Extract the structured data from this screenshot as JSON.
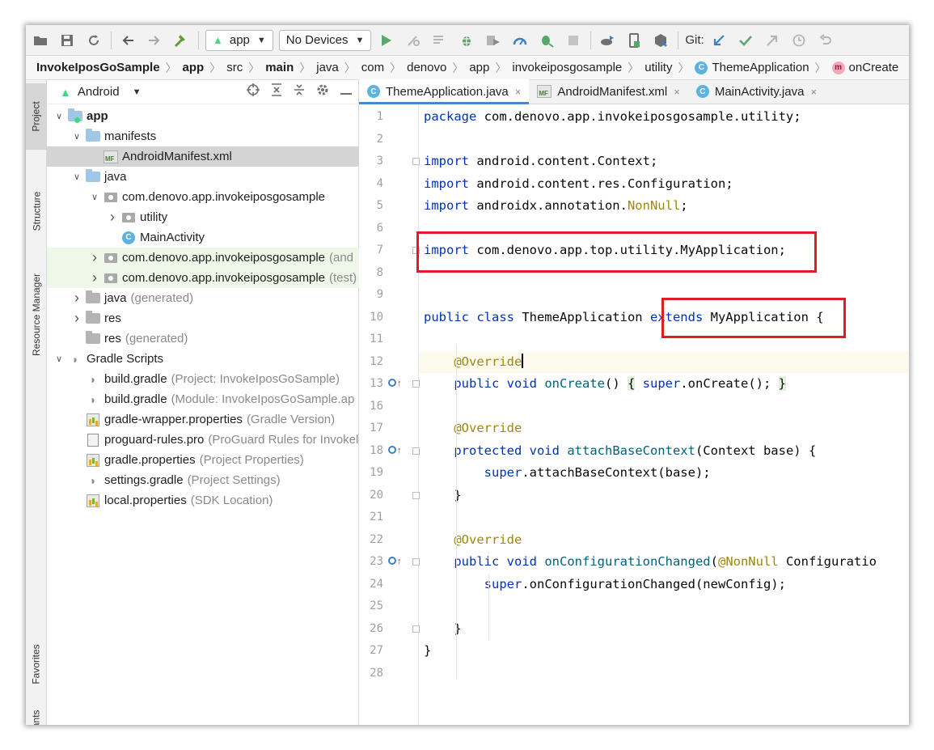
{
  "toolbar": {
    "config_selector": "app",
    "device_selector": "No Devices",
    "git_label": "Git:",
    "icons": [
      "open-folder-icon",
      "save-icon",
      "sync-icon",
      "back-icon",
      "forward-icon",
      "build-hammer-icon",
      "run-icon",
      "apply-changes-icon",
      "apply-code-changes-icon",
      "debug-icon",
      "run-with-coverage-icon",
      "profile-icon",
      "attach-debugger-icon",
      "stop-icon",
      "sync-gradle-icon",
      "device-manager-icon",
      "sdk-manager-icon",
      "git-update-icon",
      "git-commit-icon",
      "git-push-icon",
      "history-icon",
      "rollback-icon"
    ]
  },
  "breadcrumb": {
    "items": [
      "InvokeIposGoSample",
      "app",
      "src",
      "main",
      "java",
      "com",
      "denovo",
      "app",
      "invokeiposgosample",
      "utility",
      "ThemeApplication",
      "onCreate"
    ],
    "class_badge": "C",
    "method_badge": "m"
  },
  "left_strip": {
    "tabs": [
      "Project",
      "Structure",
      "Resource Manager",
      "Favorites",
      "Variants"
    ]
  },
  "project_panel": {
    "view_selector": "Android",
    "tree": [
      {
        "label": "app",
        "muted": "",
        "indent": 0,
        "arrow": "down",
        "icon": "folder"
      },
      {
        "label": "manifests",
        "muted": "",
        "indent": 1,
        "arrow": "down",
        "icon": "folder"
      },
      {
        "label": "AndroidManifest.xml",
        "muted": "",
        "indent": 2,
        "arrow": "",
        "icon": "mf"
      },
      {
        "label": "java",
        "muted": "",
        "indent": 1,
        "arrow": "down",
        "icon": "folder"
      },
      {
        "label": "com.denovo.app.invokeiposgosample",
        "muted": "",
        "indent": 2,
        "arrow": "down",
        "icon": "pkg"
      },
      {
        "label": "utility",
        "muted": "",
        "indent": 3,
        "arrow": "right",
        "icon": "pkg"
      },
      {
        "label": "MainActivity",
        "muted": "",
        "indent": 3,
        "arrow": "",
        "icon": "cls"
      },
      {
        "label": "com.denovo.app.invokeiposgosample",
        "muted": "(and",
        "indent": 2,
        "arrow": "right",
        "icon": "pkg"
      },
      {
        "label": "com.denovo.app.invokeiposgosample",
        "muted": "(test)",
        "indent": 2,
        "arrow": "right",
        "icon": "pkg"
      },
      {
        "label": "java",
        "muted": "(generated)",
        "indent": 1,
        "arrow": "right",
        "icon": "folder-gray"
      },
      {
        "label": "res",
        "muted": "",
        "indent": 1,
        "arrow": "right",
        "icon": "folder-gray"
      },
      {
        "label": "res",
        "muted": "(generated)",
        "indent": 1,
        "arrow": "",
        "icon": "folder-gray"
      },
      {
        "label": "Gradle Scripts",
        "muted": "",
        "indent": 0,
        "arrow": "down",
        "icon": "gradle"
      },
      {
        "label": "build.gradle",
        "muted": "(Project: InvokeIposGoSample)",
        "indent": 1,
        "arrow": "",
        "icon": "gradle"
      },
      {
        "label": "build.gradle",
        "muted": "(Module: InvokeIposGoSample.ap",
        "indent": 1,
        "arrow": "",
        "icon": "gradle"
      },
      {
        "label": "gradle-wrapper.properties",
        "muted": "(Gradle Version)",
        "indent": 1,
        "arrow": "",
        "icon": "props"
      },
      {
        "label": "proguard-rules.pro",
        "muted": "(ProGuard Rules for Invokel",
        "indent": 1,
        "arrow": "",
        "icon": "file"
      },
      {
        "label": "gradle.properties",
        "muted": "(Project Properties)",
        "indent": 1,
        "arrow": "",
        "icon": "props"
      },
      {
        "label": "settings.gradle",
        "muted": "(Project Settings)",
        "indent": 1,
        "arrow": "",
        "icon": "gradle"
      },
      {
        "label": "local.properties",
        "muted": "(SDK Location)",
        "indent": 1,
        "arrow": "",
        "icon": "props"
      }
    ]
  },
  "editor": {
    "tabs": [
      {
        "label": "ThemeApplication.java",
        "icon": "cls",
        "badge": "C"
      },
      {
        "label": "AndroidManifest.xml",
        "icon": "mf",
        "badge": "MF"
      },
      {
        "label": "MainActivity.java",
        "icon": "cls",
        "badge": "C"
      }
    ],
    "close_glyph": "×",
    "lines": [
      {
        "n": "1",
        "html": "<span class=\"kw\">package</span> com.denovo.app.invokeiposgosample.utility;"
      },
      {
        "n": "2",
        "html": ""
      },
      {
        "n": "3",
        "html": "<span class=\"kw\">import</span> android.content.Context;"
      },
      {
        "n": "4",
        "html": "<span class=\"kw\">import</span> android.content.res.Configuration;"
      },
      {
        "n": "5",
        "html": "<span class=\"kw\">import</span> androidx.annotation.<span class=\"ann\">NonNull</span>;"
      },
      {
        "n": "6",
        "html": ""
      },
      {
        "n": "7",
        "html": "<span class=\"kw\">import</span> com.denovo.app.top.utility.MyApplication;"
      },
      {
        "n": "8",
        "html": ""
      },
      {
        "n": "9",
        "html": ""
      },
      {
        "n": "10",
        "html": "<span class=\"kw\">public class</span> ThemeApplication <span class=\"kw\">extends</span> MyApplication {"
      },
      {
        "n": "11",
        "html": ""
      },
      {
        "n": "12",
        "html": "    <span class=\"ann\">@Override</span><span class=\"caret-line\"></span>"
      },
      {
        "n": "13",
        "html": "    <span class=\"kw\">public void</span> <span class=\"fn\">onCreate</span>() <span class=\"brace-hl\">{</span> <span class=\"kw\">super</span>.onCreate(); <span class=\"brace-hl\">}</span>"
      },
      {
        "n": "16",
        "html": ""
      },
      {
        "n": "17",
        "html": "    <span class=\"ann\">@Override</span>"
      },
      {
        "n": "18",
        "html": "    <span class=\"kw\">protected void</span> <span class=\"fn\">attachBaseContext</span>(Context base) {"
      },
      {
        "n": "19",
        "html": "        <span class=\"kw\">super</span>.attachBaseContext(base);"
      },
      {
        "n": "20",
        "html": "    }"
      },
      {
        "n": "21",
        "html": ""
      },
      {
        "n": "22",
        "html": "    <span class=\"ann\">@Override</span>"
      },
      {
        "n": "23",
        "html": "    <span class=\"kw\">public void</span> <span class=\"fn\">onConfigurationChanged</span>(<span class=\"ann\">@NonNull</span> Configuratio"
      },
      {
        "n": "24",
        "html": "        <span class=\"kw\">super</span>.onConfigurationChanged(newConfig);"
      },
      {
        "n": "25",
        "html": ""
      },
      {
        "n": "26",
        "html": "    }"
      },
      {
        "n": "27",
        "html": "}"
      },
      {
        "n": "28",
        "html": ""
      }
    ]
  }
}
